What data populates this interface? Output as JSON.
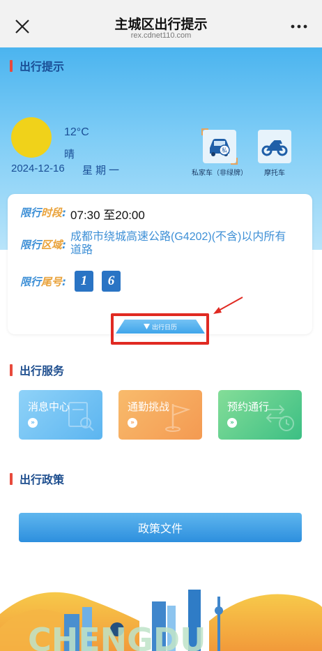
{
  "nav": {
    "title": "主城区出行提示",
    "url": "rex.cdnet110.com"
  },
  "hero": {
    "section_title": "出行提示",
    "temperature": "12°C",
    "weather": "晴",
    "date": "2024-12-16",
    "weekday": "星期一",
    "vehicles": [
      {
        "label": "私家车（非绿牌）",
        "icon": "car-icon",
        "selected": true
      },
      {
        "label": "摩托车",
        "icon": "motorcycle-icon",
        "selected": false
      }
    ]
  },
  "restriction": {
    "time_label_a": "限行",
    "time_label_b": "时段",
    "time_value": "07:30 至20:00",
    "area_label_a": "限行",
    "area_label_b": "区域",
    "area_value": "成都市绕城高速公路(G4202)(不含)以内所有道路",
    "tail_label_a": "限行",
    "tail_label_b": "尾号",
    "tail_numbers": [
      "1",
      "6"
    ],
    "calendar_tab": "出行日历"
  },
  "services": {
    "section_title": "出行服务",
    "items": [
      {
        "label": "消息中心",
        "color": "#6cc0f3"
      },
      {
        "label": "通勤挑战",
        "color": "#f6a95e"
      },
      {
        "label": "预约通行",
        "color": "#63cc8a"
      }
    ]
  },
  "policy": {
    "section_title": "出行政策",
    "button_label": "政策文件"
  },
  "colors": {
    "accent_red": "#e84a3c",
    "primary_blue": "#3d8fd6",
    "highlight_red": "#e02a22"
  }
}
